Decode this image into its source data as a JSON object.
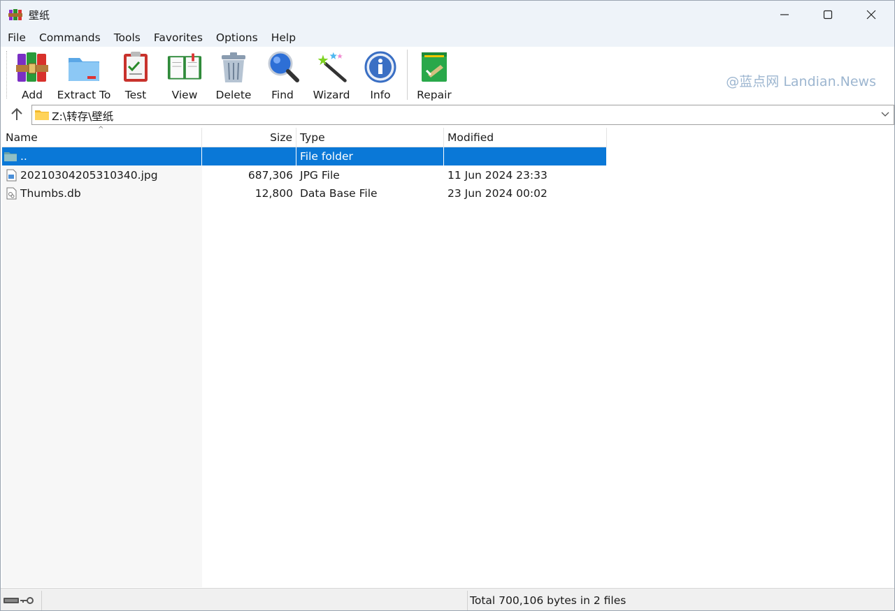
{
  "window": {
    "title": "壁纸"
  },
  "menu": [
    "File",
    "Commands",
    "Tools",
    "Favorites",
    "Options",
    "Help"
  ],
  "toolbar": {
    "items": [
      {
        "label": "Add",
        "icon": "add-archive-icon"
      },
      {
        "label": "Extract To",
        "icon": "extract-folder-icon"
      },
      {
        "label": "Test",
        "icon": "test-clipboard-icon"
      },
      {
        "label": "View",
        "icon": "view-book-icon"
      },
      {
        "label": "Delete",
        "icon": "trash-icon"
      },
      {
        "label": "Find",
        "icon": "magnifier-icon"
      },
      {
        "label": "Wizard",
        "icon": "magic-wand-icon"
      },
      {
        "label": "Info",
        "icon": "info-icon"
      },
      {
        "label": "Repair",
        "icon": "repair-kit-icon"
      }
    ],
    "watermark": "@蓝点网 Landian.News"
  },
  "address": {
    "path": "Z:\\转存\\壁纸"
  },
  "columns": {
    "name": "Name",
    "size": "Size",
    "type": "Type",
    "modified": "Modified"
  },
  "files": [
    {
      "name": "..",
      "size": "",
      "type": "File folder",
      "modified": "",
      "selected": true,
      "icon": "folder-up-icon"
    },
    {
      "name": "20210304205310340.jpg",
      "size": "687,306",
      "type": "JPG File",
      "modified": "11 Jun 2024 23:33",
      "selected": false,
      "icon": "image-file-icon"
    },
    {
      "name": "Thumbs.db",
      "size": "12,800",
      "type": "Data Base File",
      "modified": "23 Jun 2024 00:02",
      "selected": false,
      "icon": "db-file-icon"
    }
  ],
  "status": {
    "text": "Total 700,106 bytes in 2 files"
  },
  "colors": {
    "selection": "#0a78d7",
    "titlebar": "#eef3f9",
    "watermark": "#9db6d0"
  }
}
